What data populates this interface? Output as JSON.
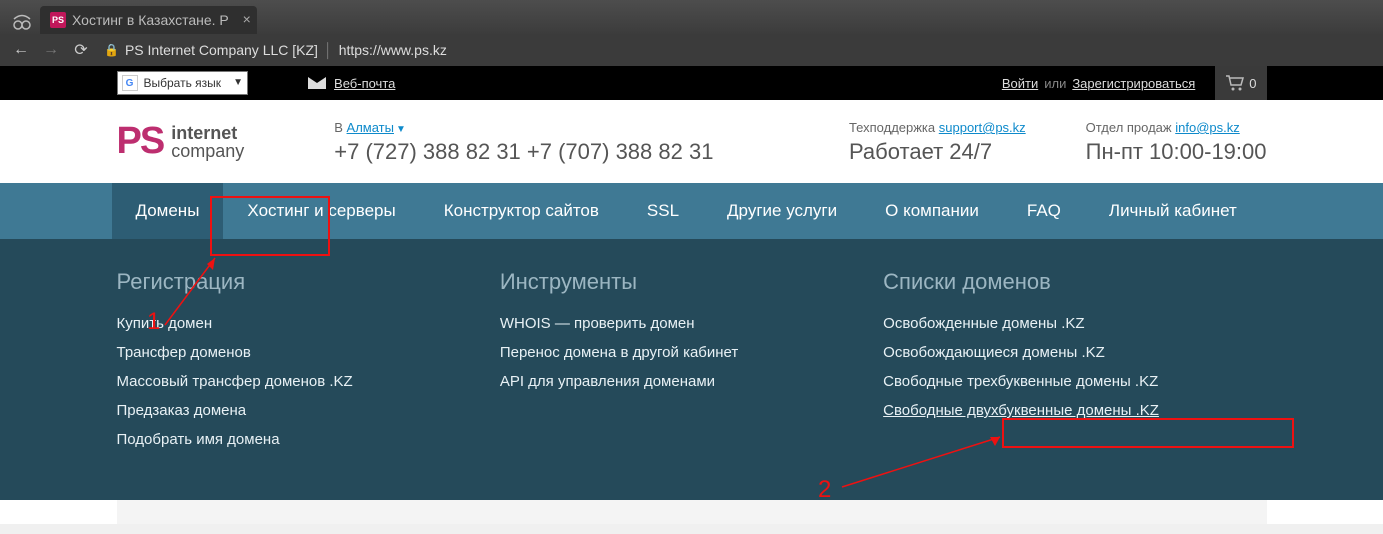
{
  "browser": {
    "tab_title": "Хостинг в Казахстане. Р",
    "favicon_text": "PS",
    "cert_owner": "PS Internet Company LLC [KZ]",
    "url": "https://www.ps.kz"
  },
  "util": {
    "lang_label": "Выбрать язык",
    "webmail": "Веб-почта",
    "login": "Войти",
    "or": "или",
    "register": "Зарегистрироваться",
    "cart_count": "0"
  },
  "header": {
    "logo_ps": "PS",
    "logo_line1": "internet",
    "logo_line2": "company",
    "city_prefix": "В ",
    "city": "Алматы",
    "phones": "+7 (727) 388 82 31 +7 (707) 388 82 31",
    "support_label": "Техподдержка",
    "support_email": "support@ps.kz",
    "support_hours": "Работает 24/7",
    "sales_label": "Отдел продаж",
    "sales_email": "info@ps.kz",
    "sales_hours": "Пн-пт 10:00-19:00"
  },
  "nav": {
    "items": [
      "Домены",
      "Хостинг и серверы",
      "Конструктор сайтов",
      "SSL",
      "Другие услуги",
      "О компании",
      "FAQ",
      "Личный кабинет"
    ]
  },
  "mega": {
    "col1": {
      "title": "Регистрация",
      "links": [
        "Купить домен",
        "Трансфер доменов",
        "Массовый трансфер доменов .KZ",
        "Предзаказ домена",
        "Подобрать имя домена"
      ]
    },
    "col2": {
      "title": "Инструменты",
      "links": [
        "WHOIS — проверить домен",
        "Перенос домена в другой кабинет",
        "API для управления доменами"
      ]
    },
    "col3": {
      "title": "Списки доменов",
      "links": [
        "Освобожденные домены .KZ",
        "Освобождающиеся домены .KZ",
        "Свободные трехбуквенные домены .KZ",
        "Свободные двухбуквенные домены .KZ"
      ]
    }
  },
  "annotations": {
    "n1": "1",
    "n2": "2"
  }
}
